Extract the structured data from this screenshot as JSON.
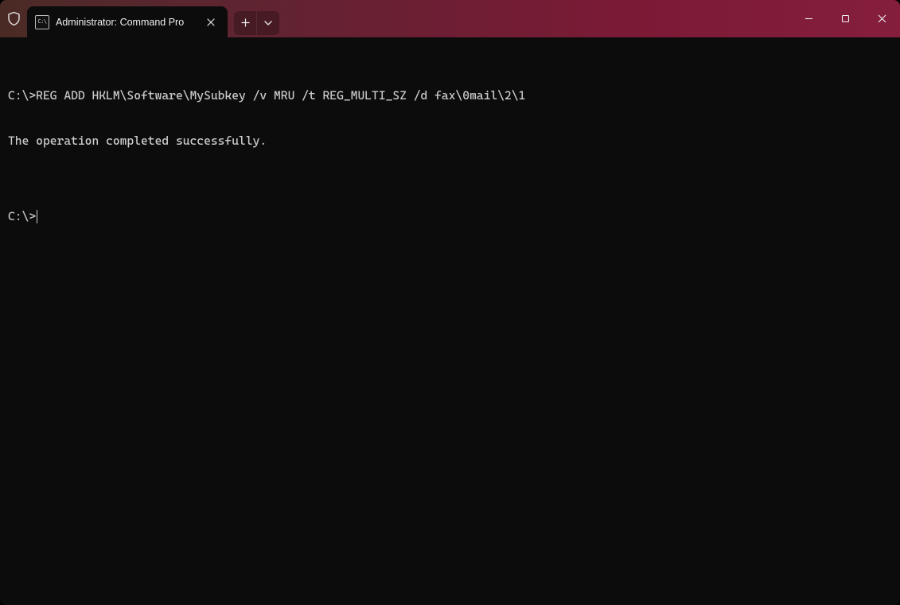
{
  "tab": {
    "title": "Administrator: Command Pro",
    "icon_text": "C:\\"
  },
  "terminal": {
    "lines": [
      "C:\\>REG ADD HKLM\\Software\\MySubkey /v MRU /t REG_MULTI_SZ /d fax\\0mail\\2\\1",
      "The operation completed successfully.",
      "",
      "C:\\>"
    ]
  },
  "icons": {
    "shield": "shield-icon",
    "close": "close-icon",
    "plus": "plus-icon",
    "chevron_down": "chevron-down-icon",
    "minimize": "minimize-icon",
    "maximize": "maximize-icon",
    "window_close": "window-close-icon"
  }
}
